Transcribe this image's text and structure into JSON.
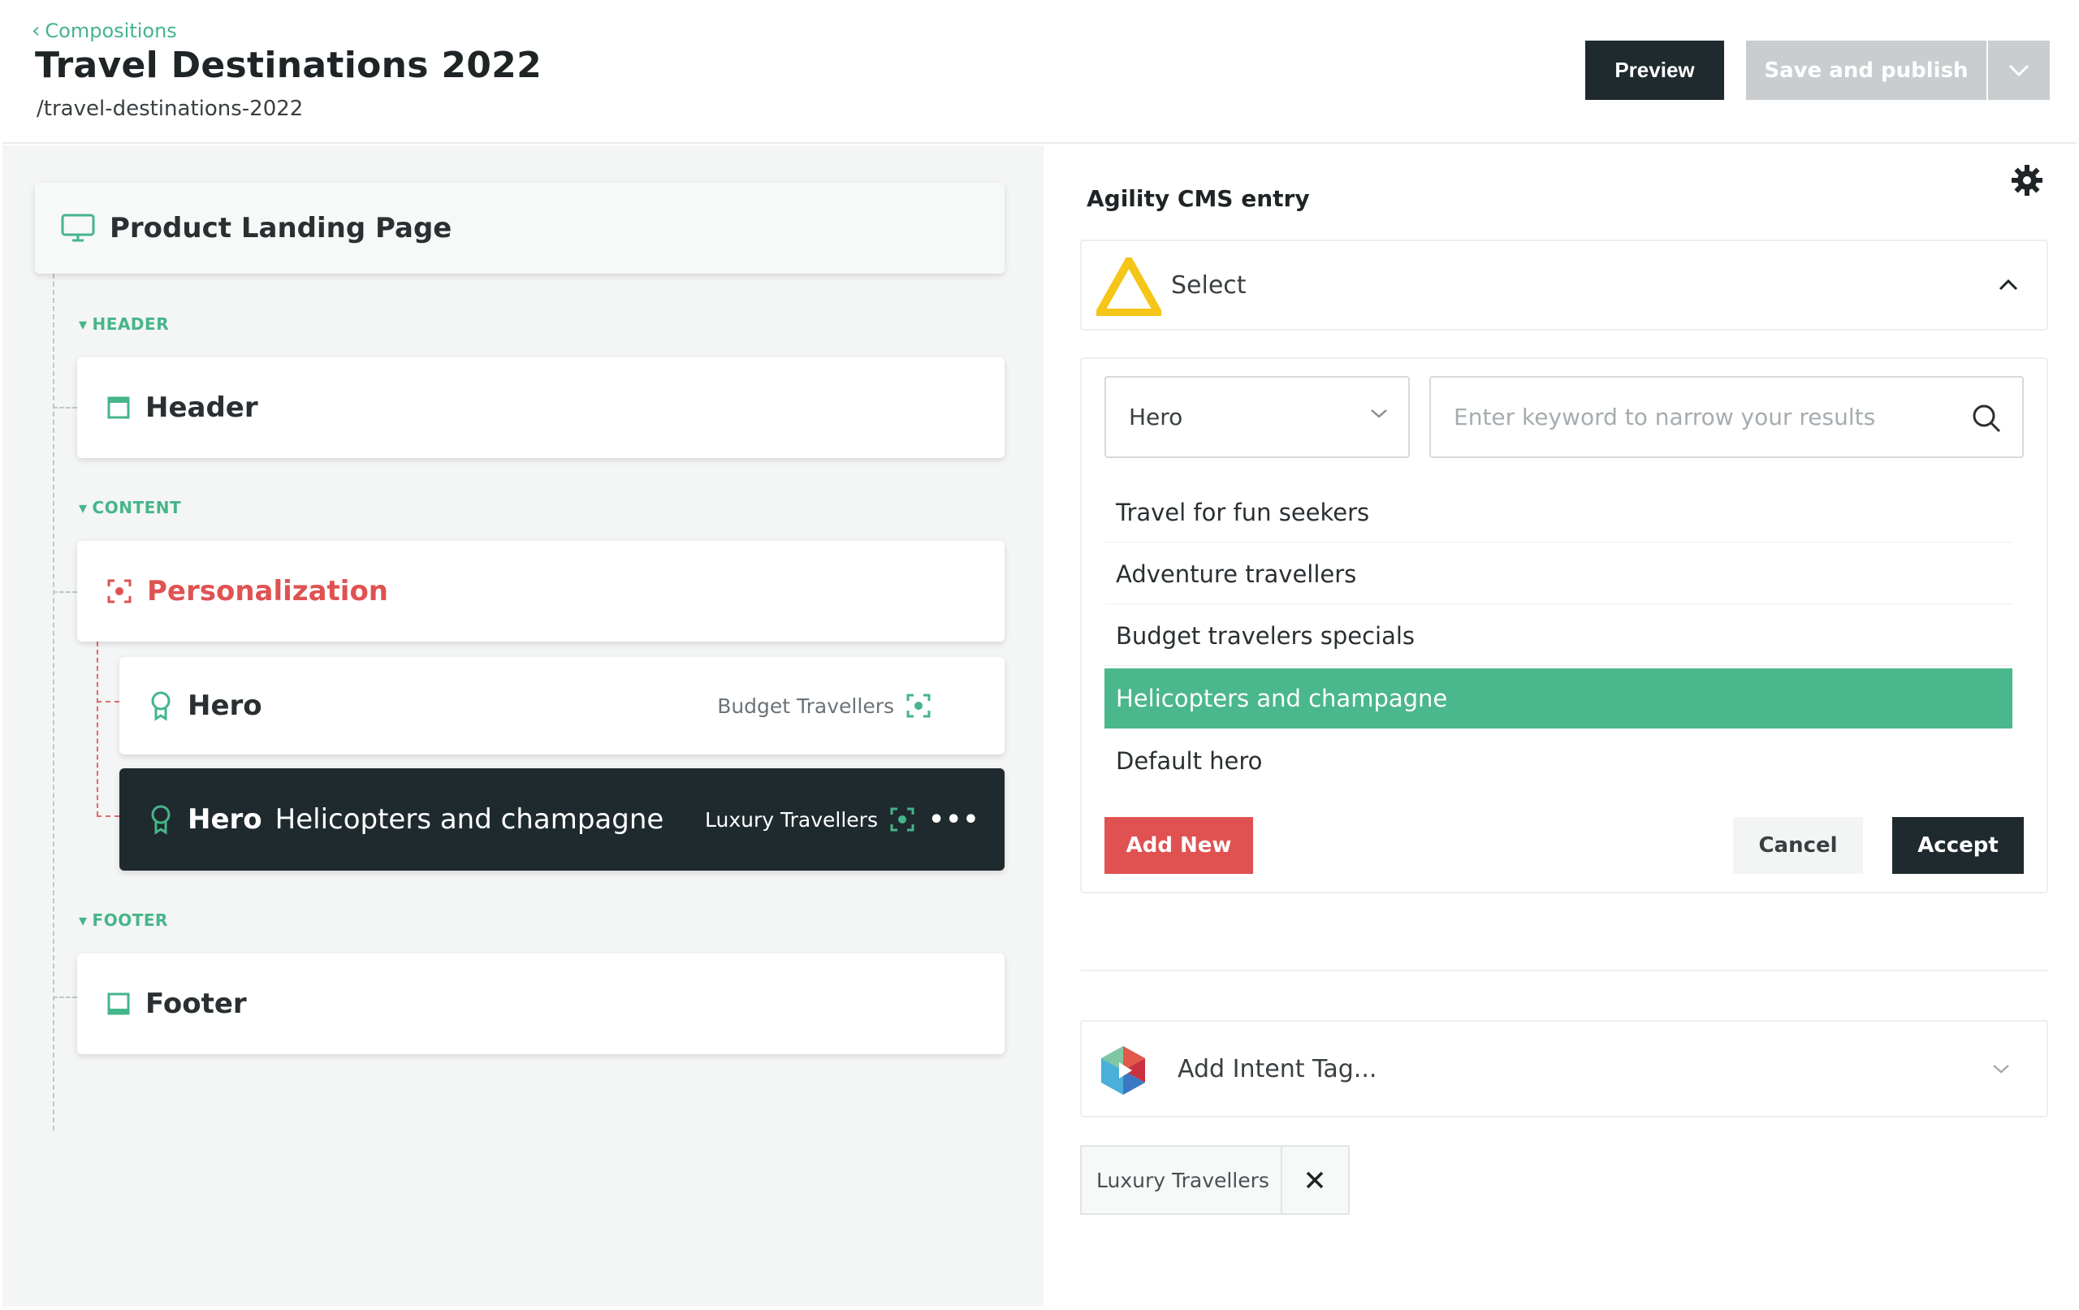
{
  "header": {
    "breadcrumb": "Compositions",
    "title": "Travel Destinations 2022",
    "slug": "/travel-destinations-2022",
    "preview_label": "Preview",
    "save_label": "Save and publish"
  },
  "tree": {
    "root_label": "Product Landing Page",
    "sections": {
      "header": "HEADER",
      "content": "CONTENT",
      "footer": "FOOTER"
    },
    "items": {
      "header": "Header",
      "personalization": "Personalization",
      "hero1": {
        "label": "Hero",
        "tag": "Budget Travellers"
      },
      "hero2": {
        "label": "Hero",
        "name": "Helicopters and champagne",
        "tag": "Luxury Travellers"
      },
      "footer": "Footer"
    },
    "more_label": "•••"
  },
  "panel": {
    "title": "Agility CMS entry",
    "select_label": "Select",
    "type_value": "Hero",
    "search_placeholder": "Enter keyword to narrow your results",
    "options": [
      "Travel for fun seekers",
      "Adventure travellers",
      "Budget travelers specials",
      "Helicopters and champagne",
      "Default hero"
    ],
    "selected_option": "Helicopters and champagne",
    "add_new_label": "Add New",
    "cancel_label": "Cancel",
    "accept_label": "Accept",
    "intent_placeholder": "Add Intent Tag...",
    "intent_chip": "Luxury Travellers"
  },
  "colors": {
    "accent_green": "#4ab78c",
    "danger_red": "#e05252",
    "dark": "#1f2a2e",
    "agility_yellow": "#f5c518"
  },
  "icons": [
    "chevron-left-icon",
    "monitor-icon",
    "header-block-icon",
    "personalization-target-icon",
    "badge-icon",
    "footer-block-icon",
    "gear-icon",
    "agility-logo-icon",
    "chevron-up-icon",
    "chevron-down-icon",
    "search-icon",
    "intent-logo-icon",
    "close-icon"
  ]
}
